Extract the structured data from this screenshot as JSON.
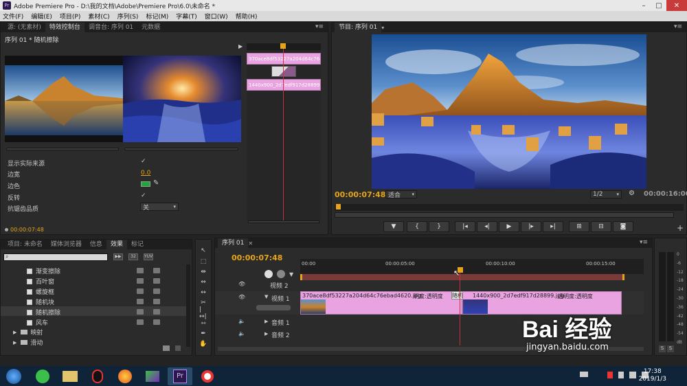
{
  "window": {
    "title": "Adobe Premiere Pro - D:\\我的文档\\Adobe\\Premiere Pro\\6.0\\未命名 *",
    "icon_text": "Pr"
  },
  "menu": [
    "文件(F)",
    "编辑(E)",
    "项目(P)",
    "素材(C)",
    "序列(S)",
    "标记(M)",
    "字幕(T)",
    "窗口(W)",
    "帮助(H)"
  ],
  "top_left_panel": {
    "tabs": [
      "源: (无素材)",
      "特效控制台",
      "调音台: 序列 01",
      "元数据"
    ],
    "active_tab": 1,
    "header": "序列 01 * 随机擦除",
    "clip_a_label": "370ace8df53227a204d64c76ebad4620.jpg",
    "clip_b_label": "1440x900_2d7edf917d28899.jpg",
    "rows": [
      {
        "label": "显示实际来源",
        "value": "✓"
      },
      {
        "label": "边宽",
        "value": "0.0"
      },
      {
        "label": "边色",
        "value": ""
      },
      {
        "label": "反转",
        "value": "✓"
      },
      {
        "label": "抗锯齿品质",
        "value": "关"
      }
    ],
    "timecode": "00:00:07:48"
  },
  "program_monitor": {
    "tab": "节目: 序列 01",
    "timecode": "00:00:07:48",
    "fit_label": "适合",
    "quality": "1/2",
    "duration": "00:00:16:00"
  },
  "project_panel": {
    "tabs": [
      "项目: 未命名",
      "媒体浏览器",
      "信息",
      "效果",
      "标记"
    ],
    "active_tab": 3,
    "badges": [
      "32",
      "YUV"
    ],
    "effects": [
      "渐变擦除",
      "百叶窗",
      "螺旋框",
      "随机块",
      "随机擦除",
      "风车"
    ],
    "selected_index": 4,
    "folders": [
      "映射",
      "滑动"
    ]
  },
  "timeline": {
    "tab": "序列 01",
    "timecode": "00:00:07:48",
    "ruler": [
      "00:00",
      "00:00:05:00",
      "00:00:10:00",
      "00:00:15:00"
    ],
    "tracks": {
      "video2": "视频 2",
      "video1": "视频 1",
      "audio1": "音频 1",
      "audio2": "音频 2"
    },
    "clip1_name": "370ace8df53227a204d64c76ebad4620.jpg",
    "clip1_fx": "明度:透明度",
    "transition": "随机擦",
    "clip2_name": "1440x900_2d7edf917d28899.jpg",
    "clip2_fx": "透明度:透明度"
  },
  "audio_meter": {
    "ticks": [
      "0",
      "-6",
      "-12",
      "-18",
      "-24",
      "-30",
      "-36",
      "-42",
      "-48",
      "-54",
      "dB"
    ],
    "solo": "S"
  },
  "watermark": {
    "text": "Bai 经验",
    "url": "jingyan.baidu.com"
  },
  "taskbar": {
    "time": "17:38",
    "date": "2019/1/3",
    "pr_label": "Pr"
  }
}
